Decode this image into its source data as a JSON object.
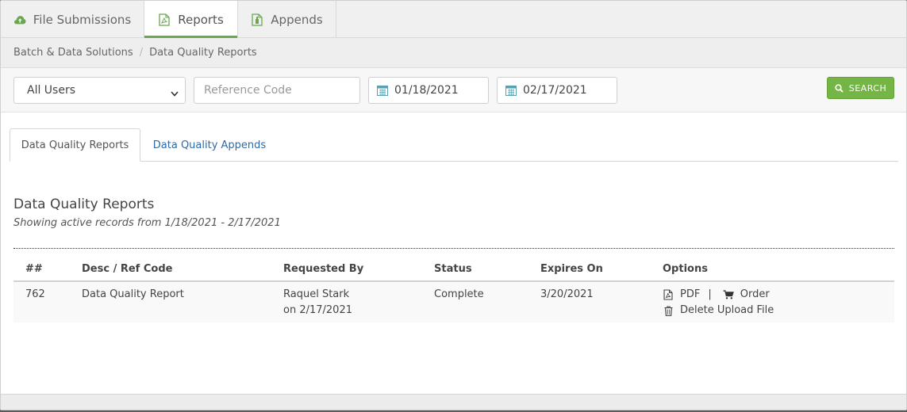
{
  "top_tabs": [
    {
      "label": "File Submissions",
      "icon": "cloud-upload-icon"
    },
    {
      "label": "Reports",
      "icon": "pdf-file-icon",
      "active": true
    },
    {
      "label": "Appends",
      "icon": "file-plus-icon"
    }
  ],
  "breadcrumb": {
    "root": "Batch & Data Solutions",
    "separator": "/",
    "current": "Data Quality Reports"
  },
  "filters": {
    "user_select": "All Users",
    "reference_placeholder": "Reference Code",
    "date_from": "01/18/2021",
    "date_to": "02/17/2021",
    "search_label": "SEARCH"
  },
  "inner_tabs": [
    {
      "label": "Data Quality Reports",
      "active": true
    },
    {
      "label": "Data Quality Appends",
      "active": false
    }
  ],
  "section": {
    "title": "Data Quality Reports",
    "subtitle": "Showing active records from 1/18/2021 - 2/17/2021"
  },
  "table": {
    "headers": [
      "##",
      "Desc / Ref Code",
      "Requested By",
      "Status",
      "Expires On",
      "Options"
    ],
    "rows": [
      {
        "id": "762",
        "desc": "Data Quality Report",
        "requested_by": "Raquel Stark",
        "requested_on": "on 2/17/2021",
        "status": "Complete",
        "expires": "3/20/2021",
        "options": {
          "pdf": "PDF",
          "pipe": "|",
          "order": "Order",
          "delete": "Delete Upload File"
        }
      }
    ]
  },
  "colors": {
    "accent_green": "#74b545",
    "link_blue": "#2f6aa6"
  }
}
